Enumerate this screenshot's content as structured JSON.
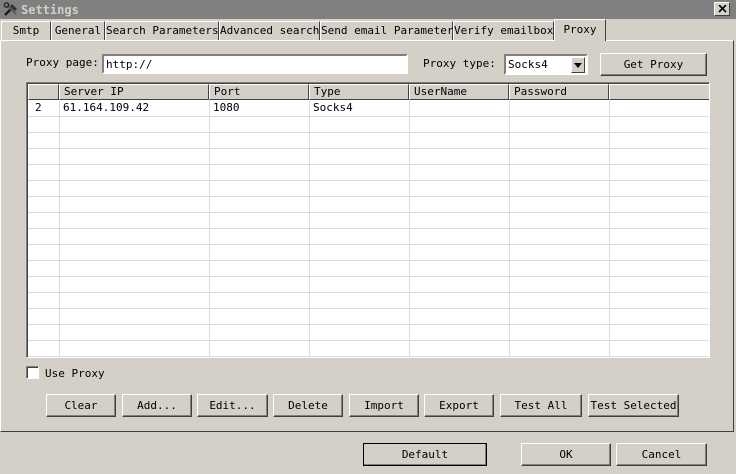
{
  "window": {
    "title": "Settings"
  },
  "tabs": [
    {
      "label": "Smtp"
    },
    {
      "label": "General"
    },
    {
      "label": "Search Parameters"
    },
    {
      "label": "Advanced search"
    },
    {
      "label": "Send email Parameter"
    },
    {
      "label": "Verify emailbox"
    },
    {
      "label": "Proxy",
      "active": true
    }
  ],
  "proxy": {
    "page_label": "Proxy page:",
    "page_value": "http://",
    "type_label": "Proxy type:",
    "type_value": "Socks4",
    "get_proxy_label": "Get Proxy"
  },
  "table": {
    "columns": [
      "",
      "Server IP",
      "Port",
      "Type",
      "UserName",
      "Password",
      ""
    ],
    "rows": [
      {
        "num": "2",
        "server_ip": "61.164.109.42",
        "port": "1080",
        "type": "Socks4",
        "username": "",
        "password": ""
      }
    ]
  },
  "use_proxy": {
    "label": "Use Proxy",
    "checked": false
  },
  "actions": {
    "clear": "Clear",
    "add": "Add...",
    "edit": "Edit...",
    "delete": "Delete",
    "import": "Import",
    "export": "Export",
    "test_all": "Test All",
    "test_selected": "Test Selected"
  },
  "footer": {
    "default": "Default",
    "ok": "OK",
    "cancel": "Cancel"
  }
}
